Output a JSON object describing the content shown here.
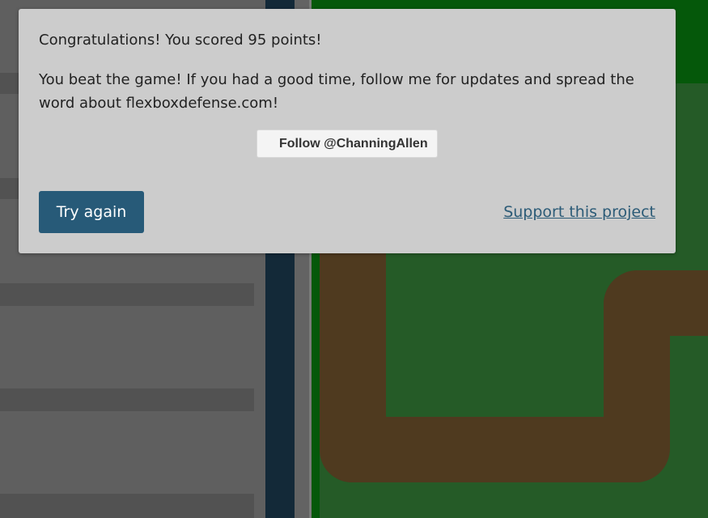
{
  "modal": {
    "score_line": "Congratulations! You scored 95 points!",
    "message": "You beat the game! If you had a good time, follow me for updates and spread the word about flexboxdefense.com!",
    "follow_label": "Follow @ChanningAllen",
    "try_again_label": "Try again",
    "support_label": "Support this project"
  },
  "colors": {
    "modal_background": "#cccccc",
    "try_again_button": "#275a78",
    "support_link": "#2c5b77",
    "board_dark": "#05580a",
    "board_field": "#255b27",
    "enemy_path": "#4f3a1f",
    "sidebar": "#5f5f5f",
    "dark_column": "#132938"
  }
}
